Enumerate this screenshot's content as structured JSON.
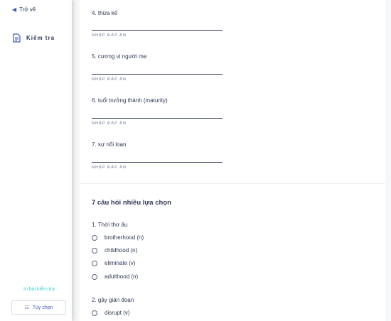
{
  "sidebar": {
    "back_label": "Trở về",
    "nav_item_label": "Kiểm tra",
    "print_label": "In bài kiểm tra",
    "options_label": "Tùy chọn"
  },
  "written_questions": [
    {
      "text": "4. thừa kế",
      "answer_label": "NHẬP ĐÁP ÁN"
    },
    {
      "text": "5. cương vị người mẹ",
      "answer_label": "NHẬP ĐÁP ÁN"
    },
    {
      "text": "6. tuổi trưởng thành (maturity)",
      "answer_label": "NHẬP ĐÁP ÁN"
    },
    {
      "text": "7. sự nổi loạn",
      "answer_label": "NHẬP ĐÁP ÁN"
    }
  ],
  "mc_section": {
    "title": "7 câu hỏi nhiều lựa chọn",
    "questions": [
      {
        "text": "1. Thời thơ ấu",
        "options": [
          "brotherhood (n)",
          "childhood (n)",
          "eliminate (v)",
          "adulthood (n)"
        ]
      },
      {
        "text": "2. gây gián đoạn",
        "options": [
          "disrupt (v)"
        ]
      }
    ]
  },
  "colors": {
    "accent": "#4257b2",
    "link": "#3ccfcf",
    "text": "#2e3856",
    "muted": "#939bb4"
  }
}
